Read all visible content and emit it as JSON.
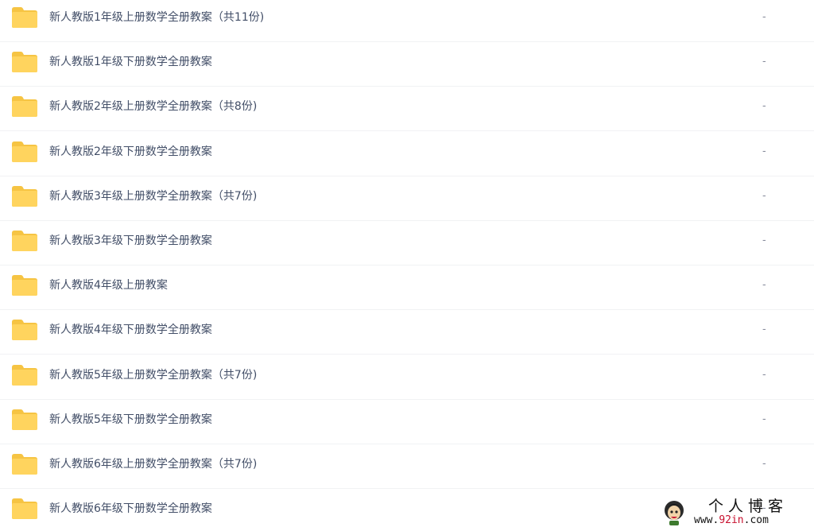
{
  "files": [
    {
      "name": "新人教版1年级上册数学全册教案（共11份)",
      "size": "-"
    },
    {
      "name": "新人教版1年级下册数学全册教案",
      "size": "-"
    },
    {
      "name": "新人教版2年级上册数学全册教案（共8份)",
      "size": "-"
    },
    {
      "name": "新人教版2年级下册数学全册教案",
      "size": "-"
    },
    {
      "name": "新人教版3年级上册数学全册教案（共7份)",
      "size": "-"
    },
    {
      "name": "新人教版3年级下册数学全册教案",
      "size": "-"
    },
    {
      "name": "新人教版4年级上册教案",
      "size": "-"
    },
    {
      "name": "新人教版4年级下册数学全册教案",
      "size": "-"
    },
    {
      "name": "新人教版5年级上册数学全册教案（共7份)",
      "size": "-"
    },
    {
      "name": "新人教版5年级下册数学全册教案",
      "size": "-"
    },
    {
      "name": "新人教版6年级上册数学全册教案（共7份)",
      "size": "-"
    },
    {
      "name": "新人教版6年级下册数学全册教案",
      "size": "-"
    }
  ],
  "icons": {
    "folder": "folder-icon"
  },
  "colors": {
    "folder_body": "#ffd45e",
    "folder_tab": "#f6c443",
    "text": "#424e67"
  },
  "watermark": {
    "title": "个人博客",
    "url_prefix": "www.",
    "url_accent": "92in",
    "url_suffix": ".com"
  }
}
